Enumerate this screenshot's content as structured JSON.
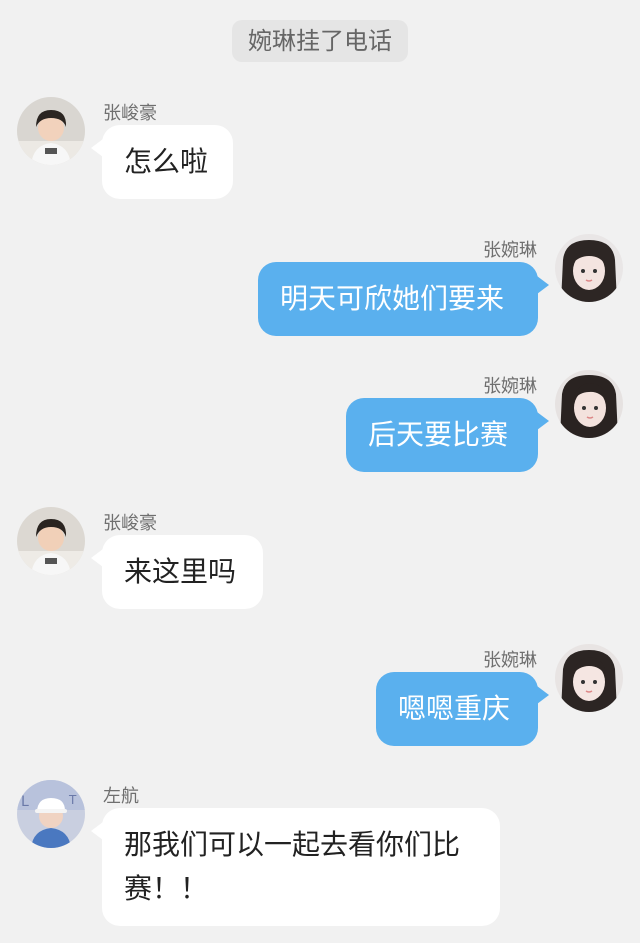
{
  "system_notice": "婉琳挂了电话",
  "messages": [
    {
      "side": "left",
      "sender": "张峻豪",
      "text": "怎么啦",
      "avatar_icon": "boy-avatar"
    },
    {
      "side": "right",
      "sender": "张婉琳",
      "text": "明天可欣她们要来",
      "avatar_icon": "girl-avatar"
    },
    {
      "side": "right",
      "sender": "张婉琳",
      "text": "后天要比赛",
      "avatar_icon": "girl-avatar"
    },
    {
      "side": "left",
      "sender": "张峻豪",
      "text": "来这里吗",
      "avatar_icon": "boy-avatar"
    },
    {
      "side": "right",
      "sender": "张婉琳",
      "text": "嗯嗯重庆",
      "avatar_icon": "girl-avatar"
    },
    {
      "side": "left",
      "sender": "左航",
      "text": "那我们可以一起去看你们比赛！！",
      "avatar_icon": "boy-cap-avatar"
    }
  ],
  "colors": {
    "background": "#f1f1f1",
    "bubble_incoming": "#ffffff",
    "bubble_outgoing": "#5ab0ee",
    "notice_bg": "#e5e5e5"
  }
}
